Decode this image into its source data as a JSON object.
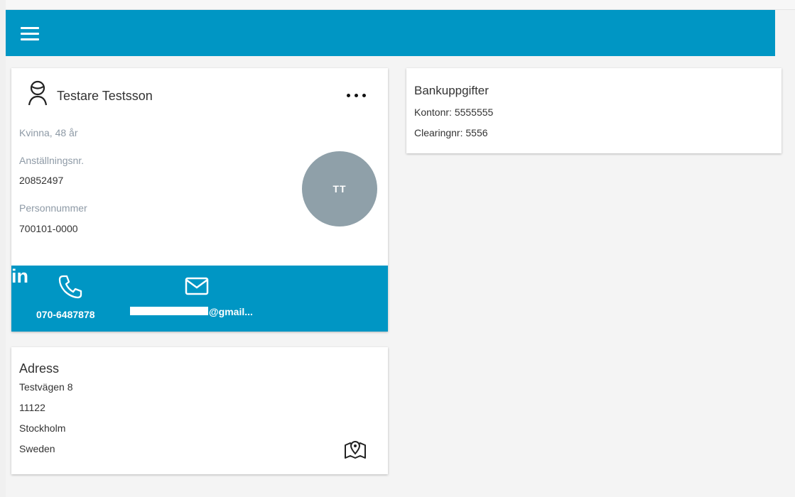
{
  "appbar": {
    "menu_icon": "menu-icon",
    "color": "#0096c4"
  },
  "profile": {
    "name": "Testare Testsson",
    "gender_age": "Kvinna, 48 år",
    "employee_no_label": "Anställningsnr.",
    "employee_no": "20852497",
    "ssn_label": "Personnummer",
    "ssn": "700101-0000",
    "avatar_initials": "TT",
    "avatar_color": "#8fa0a9",
    "more_icon": "more-horizontal-icon"
  },
  "contact": {
    "phone": "070-6487878",
    "email_visible": "@gmail...",
    "linkedin_label": "in",
    "bar_color": "#0096c4"
  },
  "address": {
    "title": "Adress",
    "street": "Testvägen 8",
    "zip": "11122",
    "city": "Stockholm",
    "country": "Sweden"
  },
  "bank": {
    "title": "Bankuppgifter",
    "account": "Kontonr: 5555555",
    "clearing": "Clearingnr: 5556"
  }
}
